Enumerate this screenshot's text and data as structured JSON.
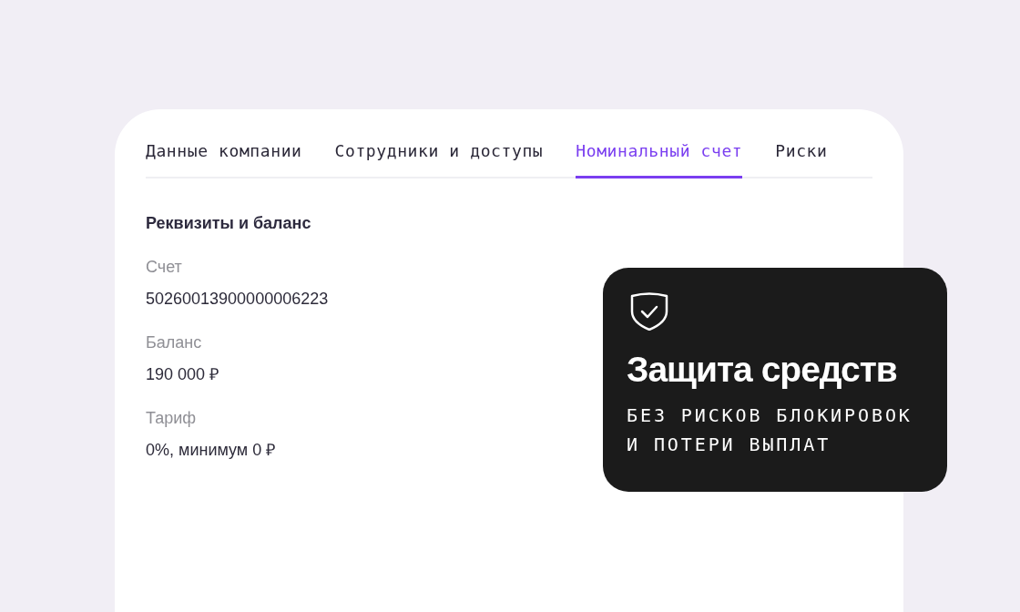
{
  "tabs": [
    {
      "label": "Данные компании",
      "selected": false
    },
    {
      "label": "Сотрудники и доступы",
      "selected": false
    },
    {
      "label": "Номинальный счет",
      "selected": true
    },
    {
      "label": "Риски",
      "selected": false
    }
  ],
  "details": {
    "title": "Реквизиты и баланс",
    "fields": [
      {
        "label": "Счет",
        "value": "50260013900000006223"
      },
      {
        "label": "Баланс",
        "value": "190 000 ₽"
      },
      {
        "label": "Тариф",
        "value": "0%, минимум 0 ₽"
      }
    ]
  },
  "promo": {
    "title": "Защита средств",
    "subtitle": "БЕЗ РИСКОВ БЛОКИРОВОК И ПОТЕРИ ВЫПЛАТ"
  }
}
